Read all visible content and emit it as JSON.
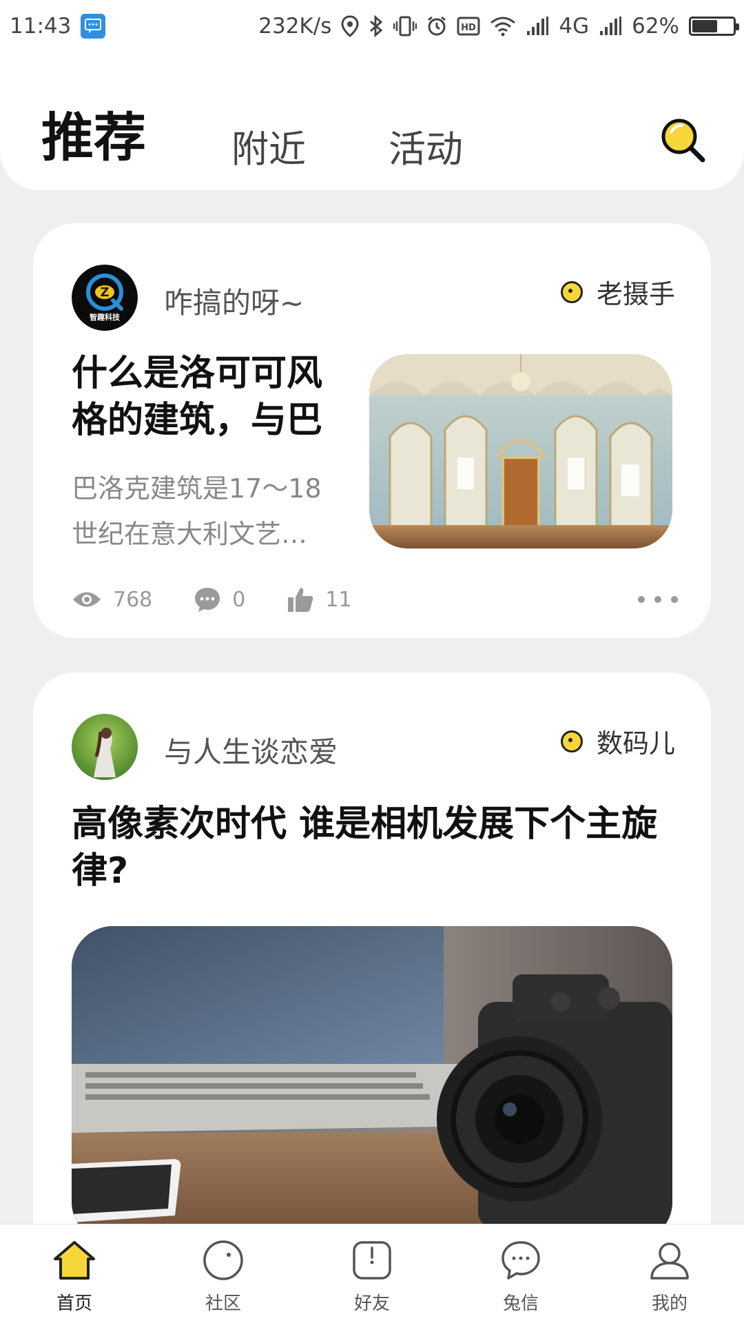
{
  "status_bar": {
    "time": "11:43",
    "speed": "232K/s",
    "network": "4G",
    "battery": "62%",
    "battery_level": 0.62
  },
  "tabs": [
    {
      "label": "推荐",
      "active": true
    },
    {
      "label": "附近",
      "active": false
    },
    {
      "label": "活动",
      "active": false
    }
  ],
  "posts": [
    {
      "author": "咋搞的呀~",
      "avatar_text": "智趣科技",
      "badge": "老摄手",
      "title": "什么是洛可可风格的建筑，与巴",
      "summary": "巴洛克建筑是17～18世纪在意大利文艺…",
      "views": "768",
      "comments": "0",
      "likes": "11"
    },
    {
      "author": "与人生谈恋爱",
      "badge": "数码儿",
      "title": "高像素次时代 谁是相机发展下个主旋律?"
    }
  ],
  "nav": [
    {
      "label": "首页",
      "icon": "home-icon",
      "active": true
    },
    {
      "label": "社区",
      "icon": "community-icon",
      "active": false
    },
    {
      "label": "好友",
      "icon": "friends-icon",
      "active": false
    },
    {
      "label": "兔信",
      "icon": "message-icon",
      "active": false
    },
    {
      "label": "我的",
      "icon": "profile-icon",
      "active": false
    }
  ],
  "colors": {
    "accent": "#f7d63a",
    "background": "#eef0ef",
    "card": "#ffffff"
  }
}
